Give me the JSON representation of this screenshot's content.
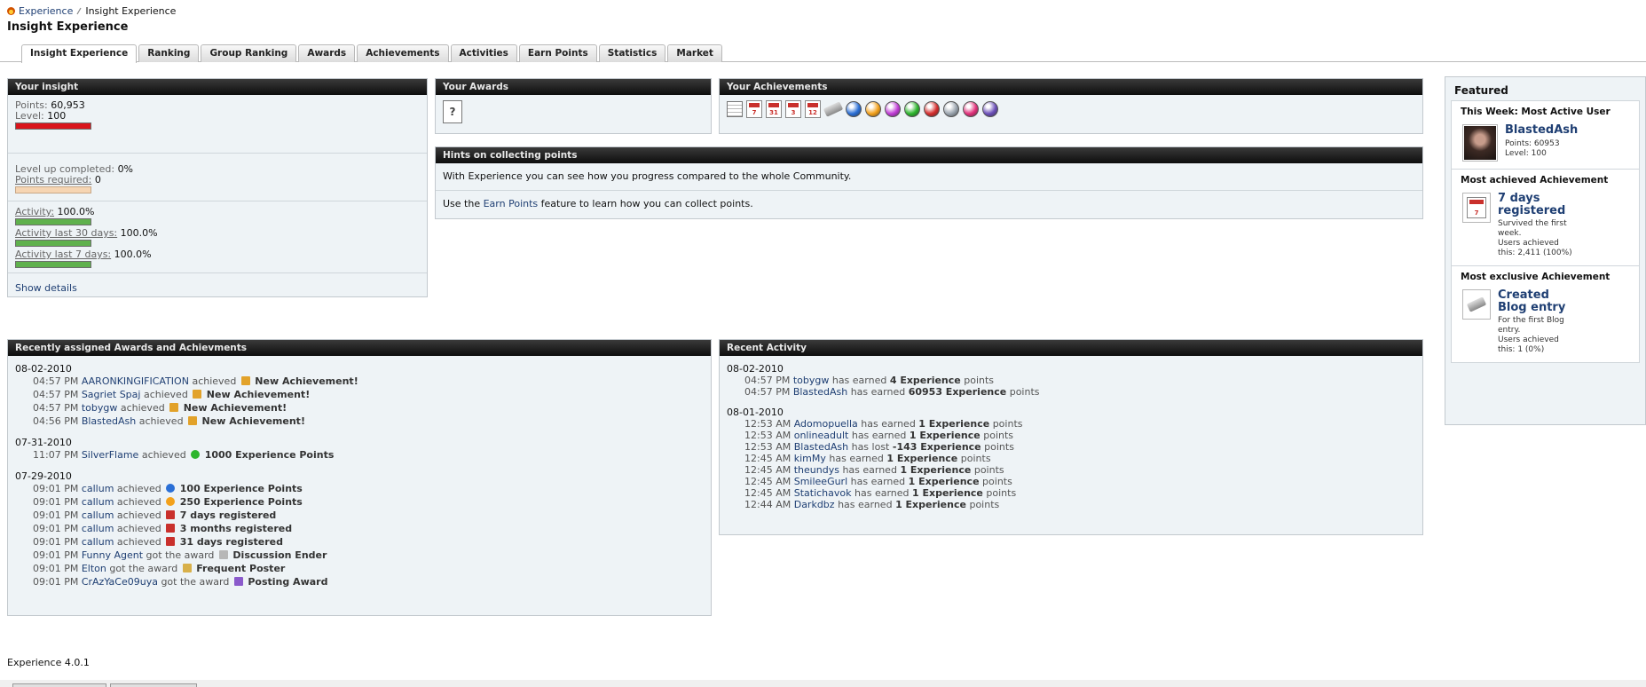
{
  "breadcrumb": {
    "home": "Experience",
    "current": "Insight Experience"
  },
  "page_title": "Insight Experience",
  "tabs": [
    "Insight Experience",
    "Ranking",
    "Group Ranking",
    "Awards",
    "Achievements",
    "Activities",
    "Earn Points",
    "Statistics",
    "Market"
  ],
  "insight": {
    "title": "Your insight",
    "points_label": "Points:",
    "points_value": "60,953",
    "level_label": "Level:",
    "level_value": "100",
    "levelup_label": "Level up completed:",
    "levelup_value": "0%",
    "required_label": "Points required:",
    "required_value": "0",
    "activity_label": "Activity:",
    "activity_value": "100.0%",
    "activity30_label": "Activity last 30 days:",
    "activity30_value": "100.0%",
    "activity7_label": "Activity last 7 days:",
    "activity7_value": "100.0%",
    "level_bar_fill": 1.0,
    "levelup_bar_fill": 1.0,
    "activity_bar_fill": 1.0,
    "activity30_bar_fill": 1.0,
    "activity7_bar_fill": 1.0,
    "show_details": "Show details"
  },
  "awards": {
    "title": "Your Awards",
    "icon_glyph": "?"
  },
  "achievements": {
    "title": "Your Achievements",
    "icons": [
      {
        "kind": "doc"
      },
      {
        "kind": "cal",
        "text": "7"
      },
      {
        "kind": "cal",
        "text": "31"
      },
      {
        "kind": "cal",
        "text": "3"
      },
      {
        "kind": "cal",
        "text": "12"
      },
      {
        "kind": "pen"
      },
      {
        "kind": "ball",
        "color": "#2a6fd6"
      },
      {
        "kind": "ball",
        "color": "#f3a11b"
      },
      {
        "kind": "ball",
        "color": "#c03cd6"
      },
      {
        "kind": "ball",
        "color": "#2db52d"
      },
      {
        "kind": "ball",
        "color": "#d42d2d"
      },
      {
        "kind": "ball",
        "color": "#9aa4ae"
      },
      {
        "kind": "ball",
        "color": "#e0307a"
      },
      {
        "kind": "ball",
        "color": "#6b4fb8"
      }
    ]
  },
  "hints": {
    "title": "Hints on collecting points",
    "line1": "With Experience you can see how you progress compared to the whole Community.",
    "line2_before": "Use the",
    "line2_link": "Earn Points",
    "line2_after": "feature to learn how you can collect points."
  },
  "featured": {
    "title": "Featured",
    "week_label": "This Week: Most Active User",
    "week_user": "BlastedAsh",
    "week_points": "Points: 60953",
    "week_level": "Level: 100",
    "most_label": "Most achieved Achievement",
    "most_name": "7 days registered",
    "most_desc": "Survived the first week.",
    "most_users": "Users achieved this: 2,411 (100%)",
    "most_icon_text": "7",
    "excl_label": "Most exclusive Achievement",
    "excl_name": "Created Blog entry",
    "excl_desc": "For the first Blog entry.",
    "excl_users": "Users achieved this: 1 (0%)"
  },
  "recent_awards": {
    "title": "Recently assigned Awards and Achievments",
    "groups": [
      {
        "date": "08-02-2010",
        "items": [
          {
            "time": "04:57 PM",
            "user": "AARONKINGIFICATION",
            "verb": "achieved",
            "icon": "#e2a22a",
            "what": "New Achievement!"
          },
          {
            "time": "04:57 PM",
            "user": "Sagriet Spaj",
            "verb": "achieved",
            "icon": "#e2a22a",
            "what": "New Achievement!"
          },
          {
            "time": "04:57 PM",
            "user": "tobygw",
            "verb": "achieved",
            "icon": "#e2a22a",
            "what": "New Achievement!"
          },
          {
            "time": "04:56 PM",
            "user": "BlastedAsh",
            "verb": "achieved",
            "icon": "#e2a22a",
            "what": "New Achievement!"
          }
        ]
      },
      {
        "date": "07-31-2010",
        "items": [
          {
            "time": "11:07 PM",
            "user": "SilverFlame",
            "verb": "achieved",
            "icon": "#2db52d",
            "what": "1000 Experience Points"
          }
        ]
      },
      {
        "date": "07-29-2010",
        "items": [
          {
            "time": "09:01 PM",
            "user": "callum",
            "verb": "achieved",
            "icon": "#2a6fd6",
            "what": "100 Experience Points"
          },
          {
            "time": "09:01 PM",
            "user": "callum",
            "verb": "achieved",
            "icon": "#f3a11b",
            "what": "250 Experience Points"
          },
          {
            "time": "09:01 PM",
            "user": "callum",
            "verb": "achieved",
            "icon": "#c9302c",
            "what": "7 days registered"
          },
          {
            "time": "09:01 PM",
            "user": "callum",
            "verb": "achieved",
            "icon": "#c9302c",
            "what": "3 months registered"
          },
          {
            "time": "09:01 PM",
            "user": "callum",
            "verb": "achieved",
            "icon": "#c9302c",
            "what": "31 days registered"
          },
          {
            "time": "09:01 PM",
            "user": "Funny Agent",
            "verb": "got the award",
            "icon": "#b7b7b7",
            "what": "Discussion Ender"
          },
          {
            "time": "09:01 PM",
            "user": "Elton",
            "verb": "got the award",
            "icon": "#d8b04a",
            "what": "Frequent Poster"
          },
          {
            "time": "09:01 PM",
            "user": "CrAzYaCe09uya",
            "verb": "got the award",
            "icon": "#8a5acb",
            "what": "Posting Award"
          }
        ]
      }
    ]
  },
  "recent_activity": {
    "title": "Recent Activity",
    "groups": [
      {
        "date": "08-02-2010",
        "items": [
          {
            "time": "04:57 PM",
            "user": "tobygw",
            "verb": "has earned",
            "amount": "4 Experience",
            "suffix": "points"
          },
          {
            "time": "04:57 PM",
            "user": "BlastedAsh",
            "verb": "has earned",
            "amount": "60953 Experience",
            "suffix": "points"
          }
        ]
      },
      {
        "date": "08-01-2010",
        "items": [
          {
            "time": "12:53 AM",
            "user": "Adomopuella",
            "verb": "has earned",
            "amount": "1 Experience",
            "suffix": "points"
          },
          {
            "time": "12:53 AM",
            "user": "onlineadult",
            "verb": "has earned",
            "amount": "1 Experience",
            "suffix": "points"
          },
          {
            "time": "12:53 AM",
            "user": "BlastedAsh",
            "verb": "has lost",
            "amount": "-143 Experience",
            "suffix": "points"
          },
          {
            "time": "12:45 AM",
            "user": "kimMy",
            "verb": "has earned",
            "amount": "1 Experience",
            "suffix": "points"
          },
          {
            "time": "12:45 AM",
            "user": "theundys",
            "verb": "has earned",
            "amount": "1 Experience",
            "suffix": "points"
          },
          {
            "time": "12:45 AM",
            "user": "SmileeGurl",
            "verb": "has earned",
            "amount": "1 Experience",
            "suffix": "points"
          },
          {
            "time": "12:45 AM",
            "user": "Statichavok",
            "verb": "has earned",
            "amount": "1 Experience",
            "suffix": "points"
          },
          {
            "time": "12:44 AM",
            "user": "Darkdbz",
            "verb": "has earned",
            "amount": "1 Experience",
            "suffix": "points"
          }
        ]
      }
    ]
  },
  "footer": {
    "version": "Experience 4.0.1"
  },
  "colors": {
    "level_bar": "#d9141b",
    "required_bar": "#f6d5b3",
    "activity_bar": "#5fb14d",
    "link": "#1f3f73"
  }
}
